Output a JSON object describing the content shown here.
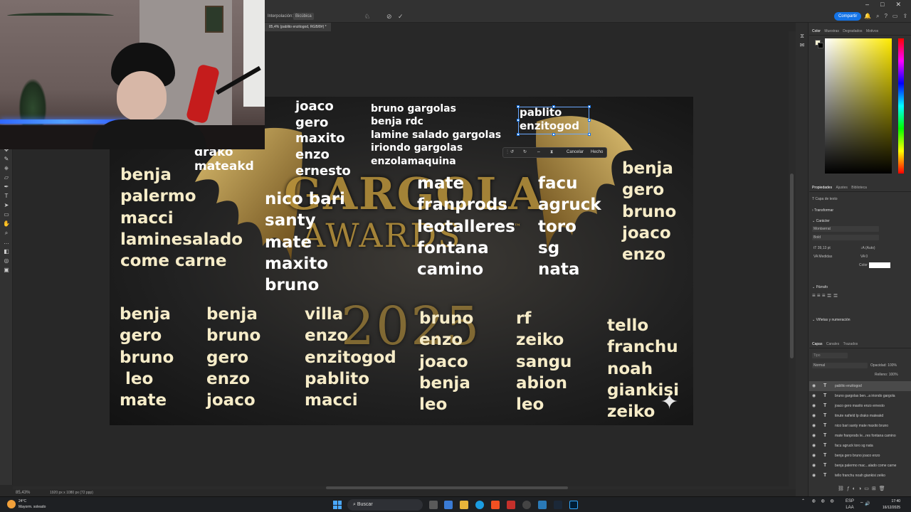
{
  "topbar": {
    "share_label": "Compartir"
  },
  "options": {
    "interpolation_label": "Interpolación:",
    "interpolation_value": "Bicúbica"
  },
  "document": {
    "tab_title": "85,4% (pablito enzitogod, RGB/8#) *"
  },
  "status": {
    "zoom": "85,43%",
    "doc_info": "1920 px x 1080 px (72 ppp)"
  },
  "artwork": {
    "logo_top": "GARGOLA",
    "logo_mid": "AWARDS",
    "logo_tm": "™",
    "logo_year": "2025"
  },
  "name_blocks": [
    [
      "joaco",
      "gero",
      "maxito",
      "enzo",
      "ernesto"
    ],
    [
      "bruno gargolas",
      "benja rdc",
      "lamine salado gargolas",
      "iriondo gargolas",
      "enzolamaquina"
    ],
    [
      "pablito",
      "enzitogod"
    ],
    [
      "drako",
      "mateakd"
    ],
    [
      "benja",
      "palermo",
      "macci",
      "laminesalado",
      "come carne"
    ],
    [
      "nico bari",
      "santy",
      "mate",
      "maxito",
      "bruno"
    ],
    [
      "mate",
      "franprods",
      "leotalleres",
      "fontana",
      "camino"
    ],
    [
      "facu",
      "agruck",
      "toro",
      "sg",
      "nata"
    ],
    [
      "benja",
      "gero",
      "bruno",
      "joaco",
      "enzo"
    ],
    [
      "benja",
      "gero",
      "bruno",
      " leo",
      "mate"
    ],
    [
      "benja",
      "bruno",
      "gero",
      "enzo",
      "joaco"
    ],
    [
      "villa",
      "enzo",
      "enzitogod",
      "pablito",
      "macci"
    ],
    [
      "bruno",
      "enzo",
      "joaco",
      "benja",
      "leo"
    ],
    [
      "rf",
      "zeiko",
      "sangu",
      "abion",
      "leo"
    ],
    [
      "tello",
      "franchu",
      "noah",
      "giankisi",
      "zeiko"
    ]
  ],
  "context_toolbar": {
    "cancel_label": "Cancelar",
    "done_label": "Hecho"
  },
  "panels": {
    "color_tabs": [
      "Color",
      "Muestras",
      "Degradados",
      "Motivos"
    ],
    "props_tabs": [
      "Propiedades",
      "Ajustes",
      "Biblioteca"
    ],
    "layer_kind": "Capa de texto",
    "transform_label": "Transformar",
    "character_label": "Carácter",
    "font_family": "Montserrat",
    "font_style": "Bold",
    "font_size": "39,13 pt",
    "leading": "(Auto)",
    "tracking_label": "Medidas",
    "tracking_value": "0",
    "color_label": "Color",
    "paragraph_label": "Párrafo",
    "bullets_label": "Viñetas y numeración",
    "layers_tabs": [
      "Capas",
      "Canales",
      "Trazados"
    ],
    "blend_mode": "Normal",
    "opacity_label": "Opacidad:",
    "opacity_value": "100%",
    "fill_label": "Relleno:",
    "fill_value": "100%",
    "search_placeholder": "Tipo",
    "layers": [
      "pablito enzitogod",
      "bruno gargolas ben...a iriondo gargola",
      "joaco gero maxito enzo ernesto",
      "tinute nafield lp drako mateakd",
      "nico bari santy mate maxito bruno",
      "mate franprods le...res fontana camino",
      "facu agruck toro sg nata",
      "benja gero bruno joaco enzo",
      "benja palermo mac...alado come carne",
      "tello franchu noah giankisi zeiko"
    ]
  },
  "taskbar": {
    "temperature": "24°C",
    "weather": "Mayorm. soleado",
    "search_label": "Buscar",
    "lang_top": "ESP",
    "lang_bottom": "LAA",
    "time": "17:40",
    "date": "16/12/2025"
  },
  "colors": {
    "accent": "#1473e6",
    "name_cream": "#f6ecc8",
    "gold": "#b8923a"
  }
}
